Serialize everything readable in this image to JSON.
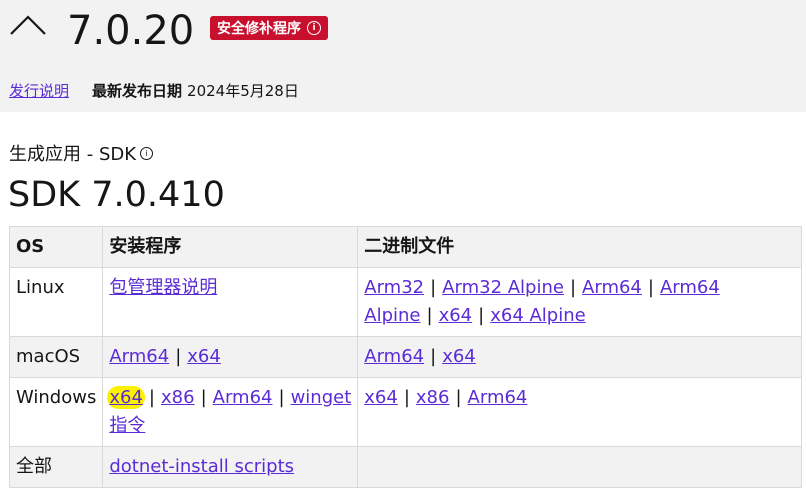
{
  "header": {
    "version": "7.0.20",
    "badge_label": "安全修补程序",
    "release_notes_label": "发行说明",
    "release_date_label": "最新发布日期",
    "release_date_value": "2024年5月28日"
  },
  "section": {
    "subtitle": "生成应用 - SDK",
    "sdk_title": "SDK 7.0.410"
  },
  "table": {
    "headers": {
      "os": "OS",
      "installers": "安装程序",
      "binaries": "二进制文件"
    },
    "rows": {
      "linux": {
        "os": "Linux",
        "installers": [
          "包管理器说明"
        ],
        "binaries": [
          "Arm32",
          "Arm32 Alpine",
          "Arm64",
          "Arm64 Alpine",
          "x64",
          "x64 Alpine"
        ]
      },
      "macos": {
        "os": "macOS",
        "installers": [
          "Arm64",
          "x64"
        ],
        "binaries": [
          "Arm64",
          "x64"
        ]
      },
      "windows": {
        "os": "Windows",
        "installers": [
          "x64",
          "x86",
          "Arm64",
          "winget 指令"
        ],
        "binaries": [
          "x64",
          "x86",
          "Arm64"
        ]
      },
      "all": {
        "os": "全部",
        "installers": [
          "dotnet-install scripts"
        ],
        "binaries": []
      }
    }
  },
  "colors": {
    "link": "#5b2bd6",
    "badge": "#c8102e",
    "highlight": "#fcf200",
    "band": "#f2f2f2"
  },
  "icons": [
    "chevron-up-icon",
    "info-icon"
  ]
}
